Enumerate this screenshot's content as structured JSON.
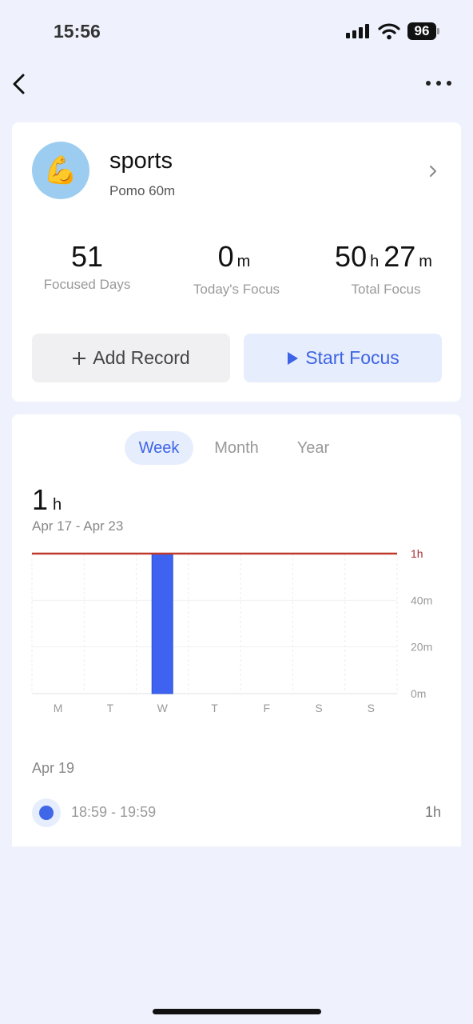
{
  "status_bar": {
    "time": "15:56",
    "battery": "96"
  },
  "task": {
    "emoji": "💪",
    "title": "sports",
    "subtitle": "Pomo 60m"
  },
  "stats": [
    {
      "value_parts": [
        "51"
      ],
      "label": "Focused Days"
    },
    {
      "value_parts": [
        "0",
        "m"
      ],
      "label": "Today's Focus"
    },
    {
      "value_parts": [
        "50",
        "h",
        "27",
        "m"
      ],
      "label": "Total Focus"
    }
  ],
  "buttons": {
    "add_record": "Add Record",
    "start_focus": "Start Focus"
  },
  "tabs": [
    "Week",
    "Month",
    "Year"
  ],
  "active_tab": "Week",
  "summary": {
    "value": "1",
    "unit": "h",
    "range": "Apr 17 - Apr 23"
  },
  "chart_data": {
    "type": "bar",
    "categories": [
      "M",
      "T",
      "W",
      "T",
      "F",
      "S",
      "S"
    ],
    "values": [
      0,
      0,
      60,
      0,
      0,
      0,
      0
    ],
    "y_unit": "minutes",
    "ylim": [
      0,
      60
    ],
    "y_ticks": [
      {
        "value": 0,
        "label": "0m"
      },
      {
        "value": 20,
        "label": "20m"
      },
      {
        "value": 40,
        "label": "40m"
      },
      {
        "value": 60,
        "label": "1h"
      }
    ],
    "goal_line": {
      "value": 60,
      "label": "1h",
      "color": "#c0392b"
    },
    "bar_color": "#3d63f0",
    "grid": true
  },
  "records": {
    "date": "Apr 19",
    "items": [
      {
        "time": "18:59 - 19:59",
        "duration": "1h"
      }
    ]
  },
  "colors": {
    "accent": "#3d64e6",
    "background": "#eff2fc"
  }
}
